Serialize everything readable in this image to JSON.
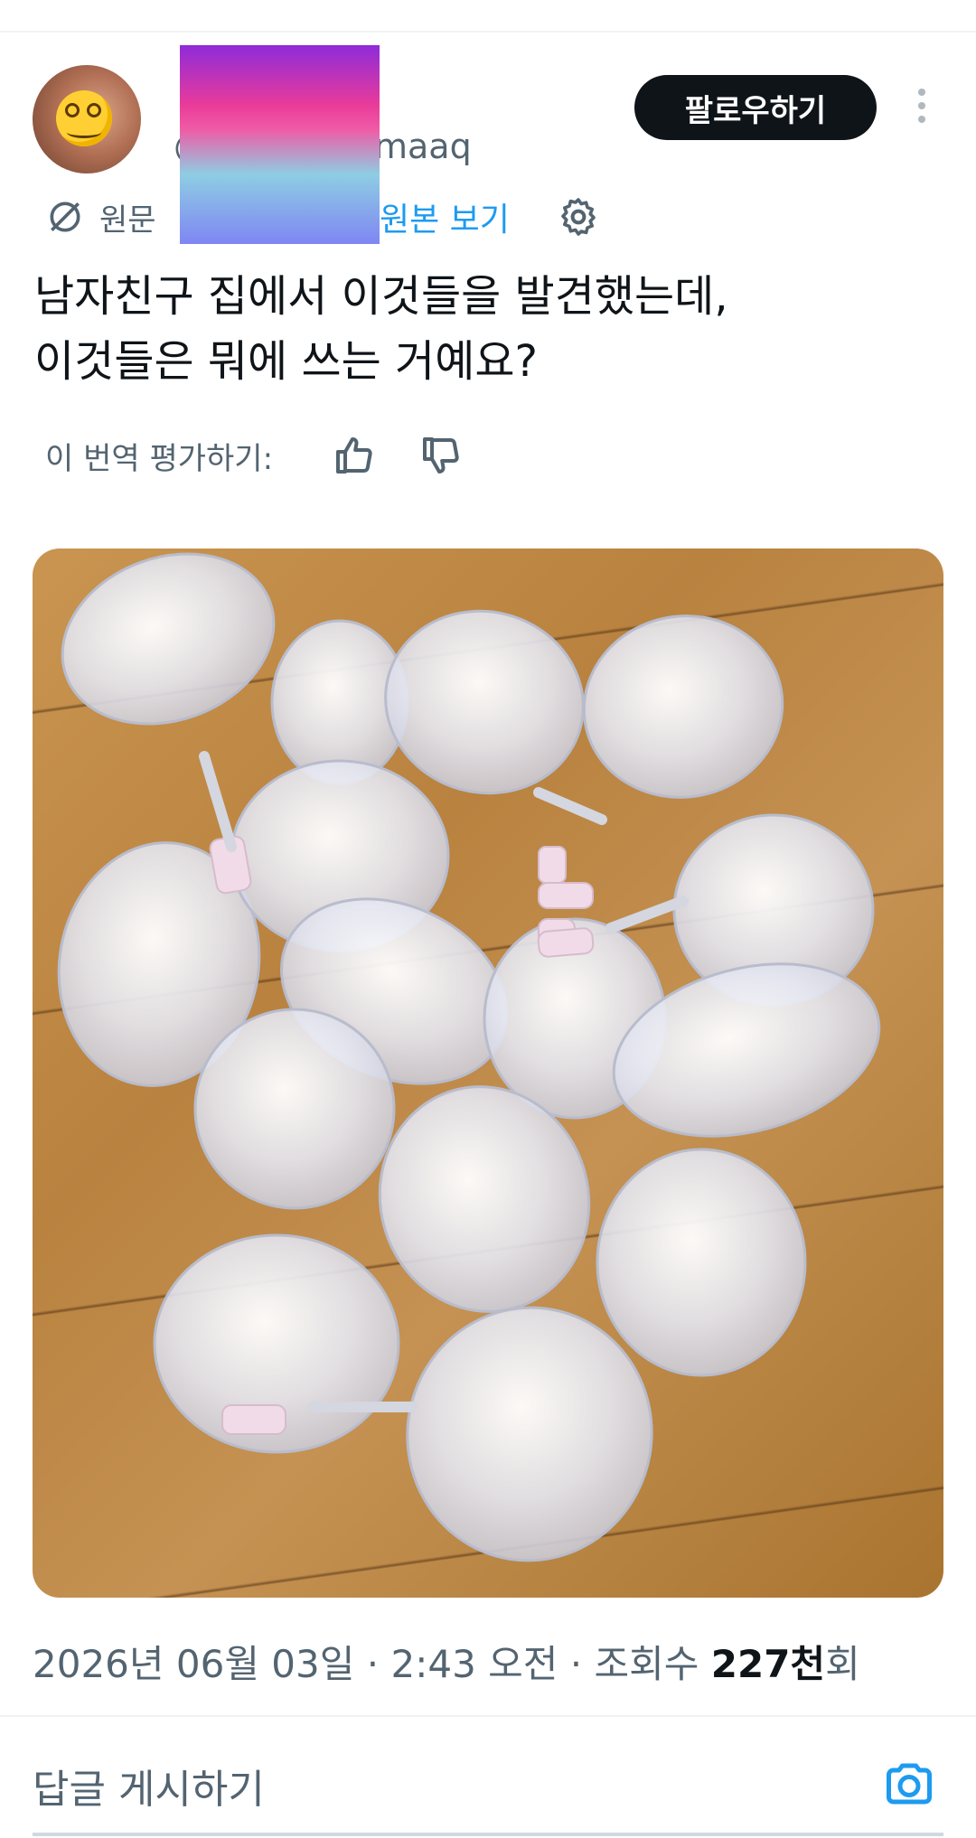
{
  "author": {
    "name_prefix": "ㅣ",
    "handle_prefix": "@",
    "handle_suffix": "maaq"
  },
  "header": {
    "follow_label": "팔로우하기",
    "more_icon": "more-vertical-icon"
  },
  "translation": {
    "original_label": "원문",
    "view_original_label": "원본 보기",
    "settings_icon": "gear-icon",
    "rate_label": "이 번역 평가하기:"
  },
  "post": {
    "line1": "남자친구 집에서 이것들을 발견했는데,",
    "line2": "이것들은 뭐에 쓰는 거예요?"
  },
  "meta": {
    "date": "2026년 06월 03일",
    "sep1": " · ",
    "time": "2:43 오전",
    "sep2": " · 조회수 ",
    "views": "227천",
    "views_suffix": "회"
  },
  "reply": {
    "placeholder": "답글 게시하기",
    "camera_icon": "camera-icon"
  },
  "colors": {
    "accent": "#1d9bf0",
    "text_primary": "#0f1419",
    "text_secondary": "#536471"
  }
}
